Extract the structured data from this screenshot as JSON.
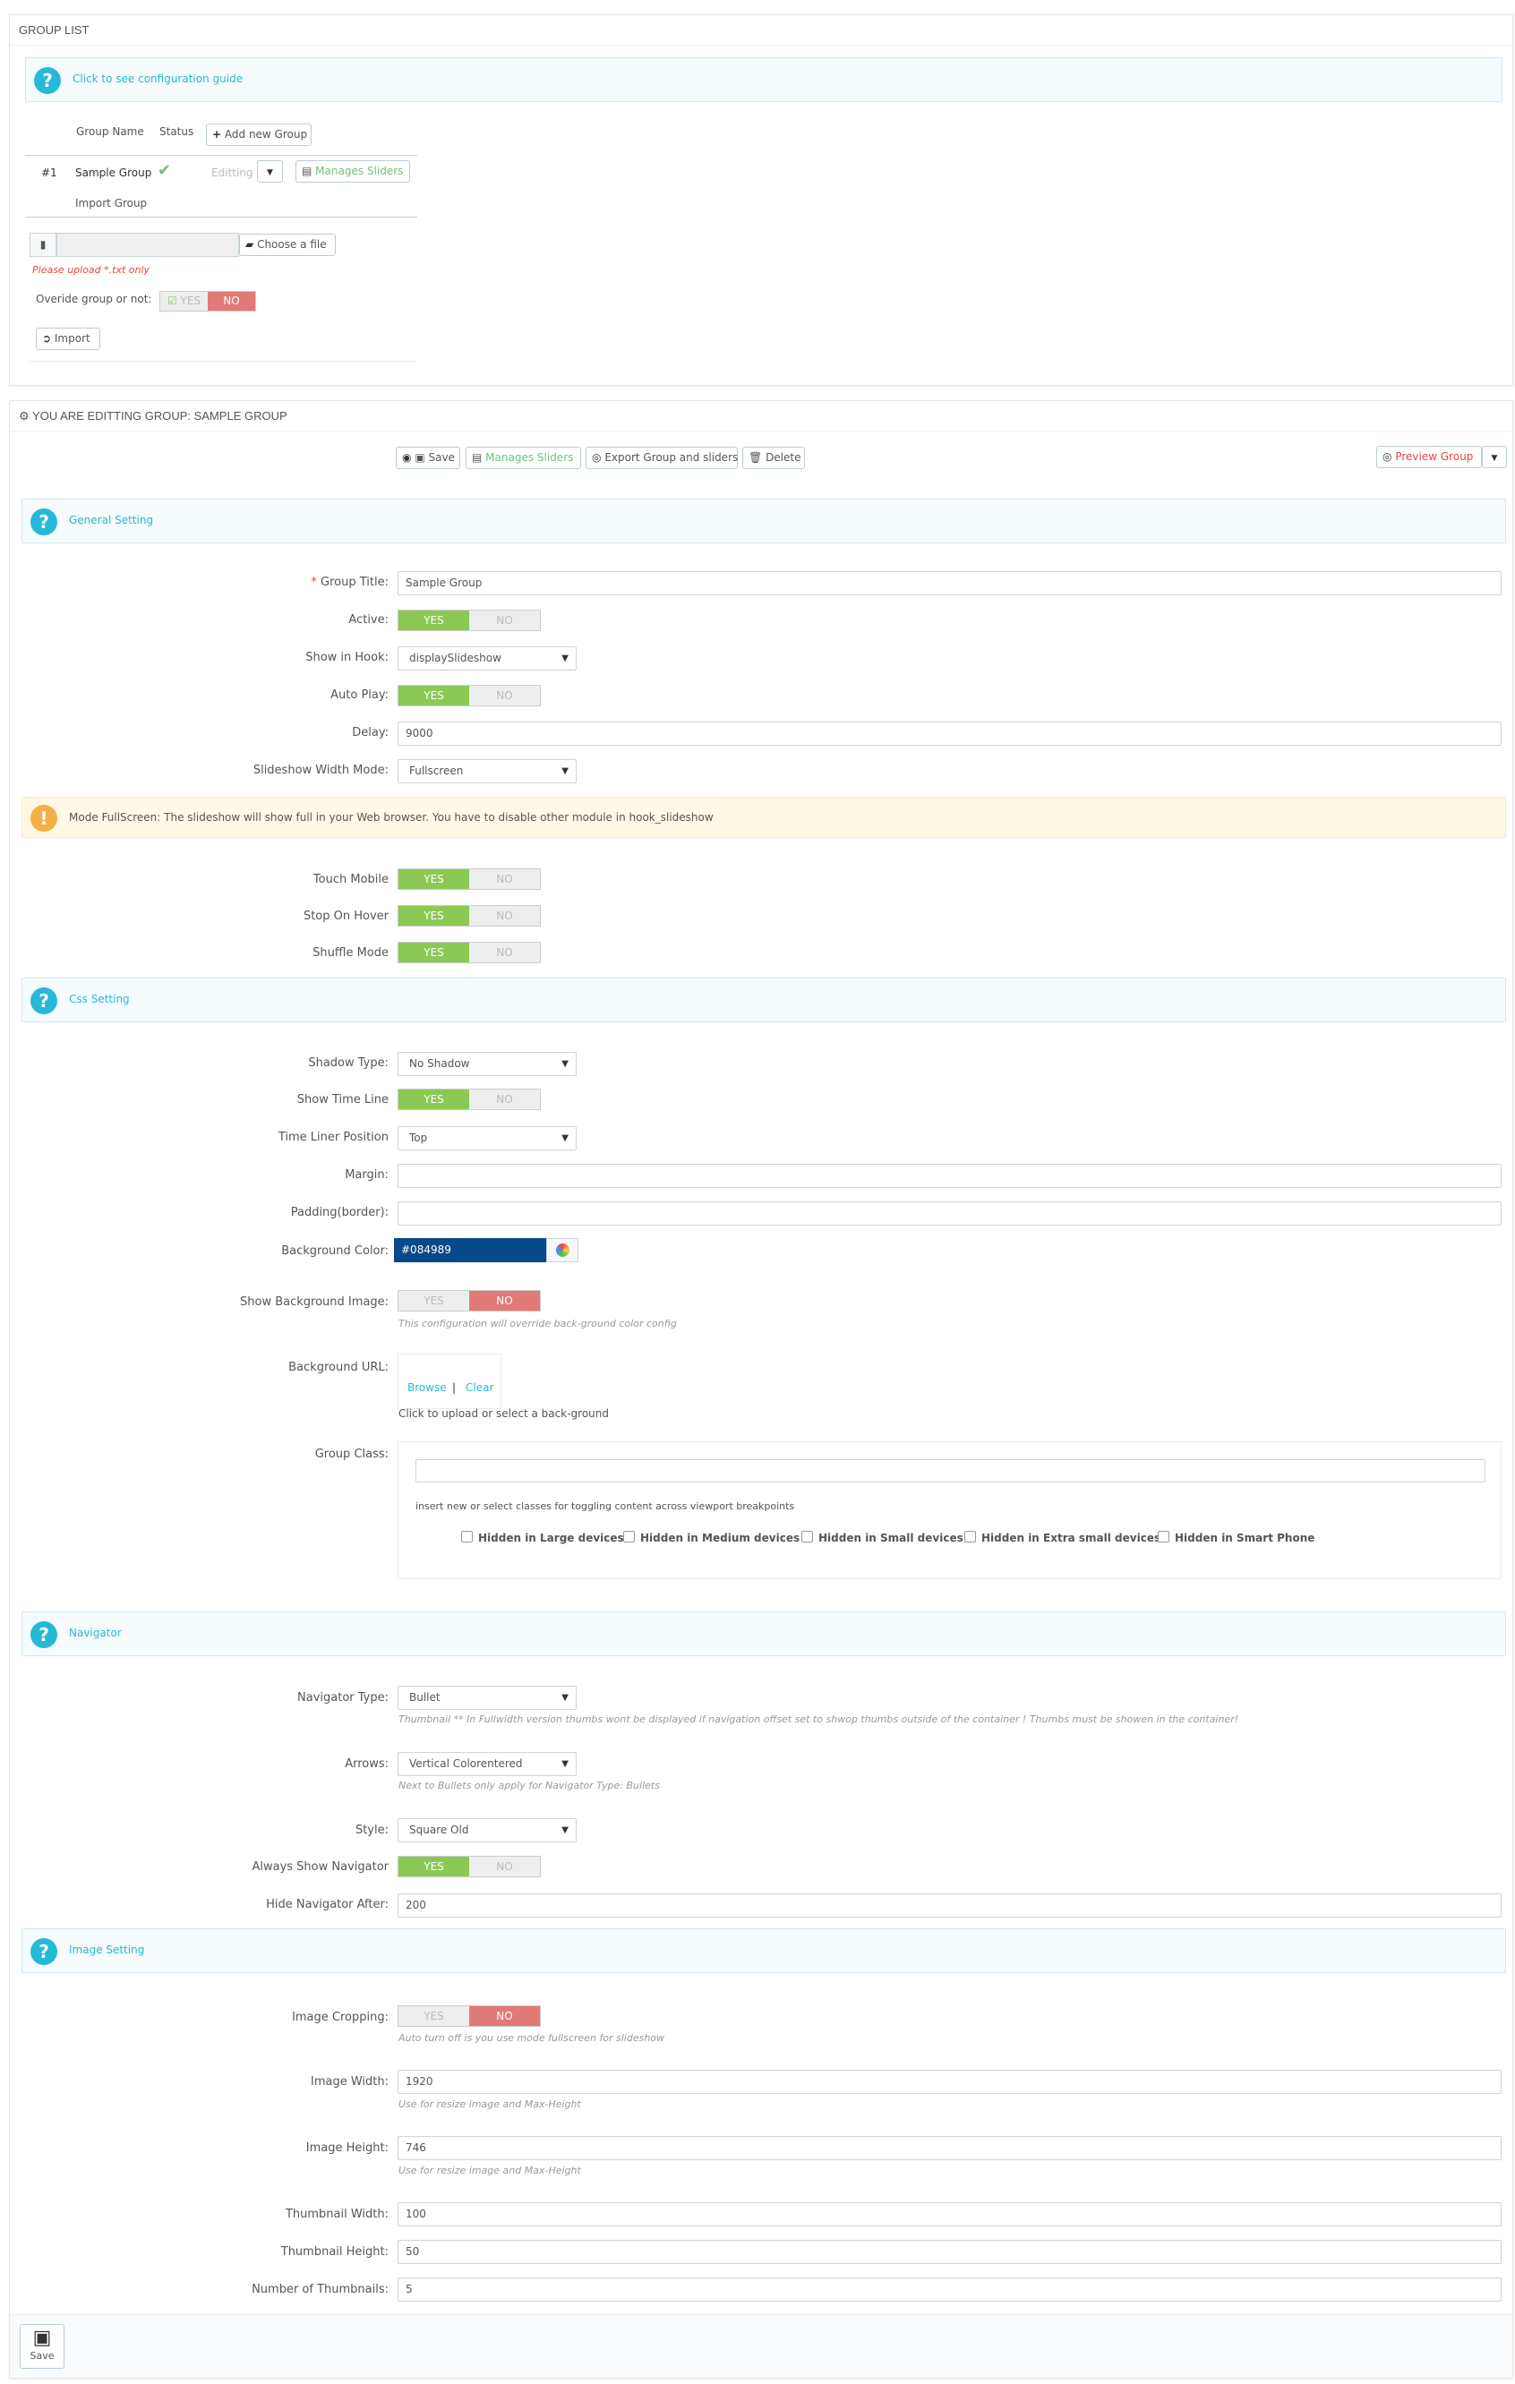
{
  "group_list": {
    "title": "GROUP LIST",
    "guide_link": "Click to see configuration guide",
    "col_group_name": "Group Name",
    "col_status": "Status",
    "add_group_btn": "Add new Group",
    "row": {
      "id": "#1",
      "name": "Sample Group",
      "state": "Editting",
      "manage_btn": "Manages Sliders"
    },
    "import_group": "Import Group",
    "choose_file_btn": "Choose a file",
    "upload_hint": "Please upload *.txt only",
    "override_label": "Overide group or not:",
    "override_yes": "YES",
    "override_no": "NO",
    "import_btn": "Import"
  },
  "editing": {
    "title": "YOU ARE EDITTING GROUP: SAMPLE GROUP",
    "toolbar": {
      "save": "Save",
      "manage": "Manages Sliders",
      "export": "Export Group and sliders",
      "delete": "Delete",
      "preview": "Preview Group"
    }
  },
  "general": {
    "heading": "General Setting",
    "group_title_label": "Group Title:",
    "group_title_value": "Sample Group",
    "active_label": "Active:",
    "hook_label": "Show in Hook:",
    "hook_value": "displaySlideshow",
    "autoplay_label": "Auto Play:",
    "delay_label": "Delay:",
    "delay_value": "9000",
    "width_mode_label": "Slideshow Width Mode:",
    "width_mode_value": "Fullscreen",
    "warning": "Mode FullScreen: The slideshow will show full in your Web browser. You have to disable other module in hook_slideshow",
    "touch_label": "Touch Mobile",
    "stop_hover_label": "Stop On Hover",
    "shuffle_label": "Shuffle Mode"
  },
  "css": {
    "heading": "Css Setting",
    "shadow_label": "Shadow Type:",
    "shadow_value": "No Shadow",
    "timeline_label": "Show Time Line",
    "timeline_pos_label": "Time Liner Position",
    "timeline_pos_value": "Top",
    "margin_label": "Margin:",
    "padding_label": "Padding(border):",
    "bg_color_label": "Background Color:",
    "bg_color_value": "#084989",
    "show_bg_image_label": "Show Background Image:",
    "show_bg_image_hint": "This configuration will override back-ground color config",
    "bg_url_label": "Background URL:",
    "browse": "Browse",
    "separator": "|",
    "clear": "Clear",
    "bg_url_hint": "Click to upload or select a back-ground",
    "group_class_label": "Group Class:",
    "group_class_hint": "insert new or select classes for toggling content across viewport breakpoints",
    "checkboxes": [
      "Hidden in Large devices",
      "Hidden in Medium devices",
      "Hidden in Small devices",
      "Hidden in Extra small devices",
      "Hidden in Smart Phone"
    ]
  },
  "navigator": {
    "heading": "Navigator",
    "type_label": "Navigator Type:",
    "type_value": "Bullet",
    "type_hint": "Thumbnail ** In Fullwidth version thumbs wont be displayed if navigation offset set to shwop thumbs outside of the container ! Thumbs must be showen in the container!",
    "arrows_label": "Arrows:",
    "arrows_value": "Vertical Colorentered",
    "arrows_hint": "Next to Bullets only apply for Navigator Type: Bullets",
    "style_label": "Style:",
    "style_value": "Square Old",
    "always_label": "Always Show Navigator",
    "hide_after_label": "Hide Navigator After:",
    "hide_after_value": "200"
  },
  "image": {
    "heading": "Image Setting",
    "cropping_label": "Image Cropping:",
    "cropping_hint": "Auto turn off is you use mode fullscreen for slideshow",
    "width_label": "Image Width:",
    "width_value": "1920",
    "width_hint": "Use for resize image and Max-Height",
    "height_label": "Image Height:",
    "height_value": "746",
    "height_hint": "Use for resize image and Max-Height",
    "thumb_w_label": "Thumbnail Width:",
    "thumb_w_value": "100",
    "thumb_h_label": "Thumbnail Height:",
    "thumb_h_value": "50",
    "num_thumbs_label": "Number of Thumbnails:",
    "num_thumbs_value": "5",
    "save": "Save"
  },
  "switch": {
    "yes": "YES",
    "no": "NO"
  },
  "colors": {
    "accent": "#25b9d7",
    "yes_on": "#8bc954",
    "no_on": "#e27a78",
    "bg_swatch": "#084989"
  }
}
